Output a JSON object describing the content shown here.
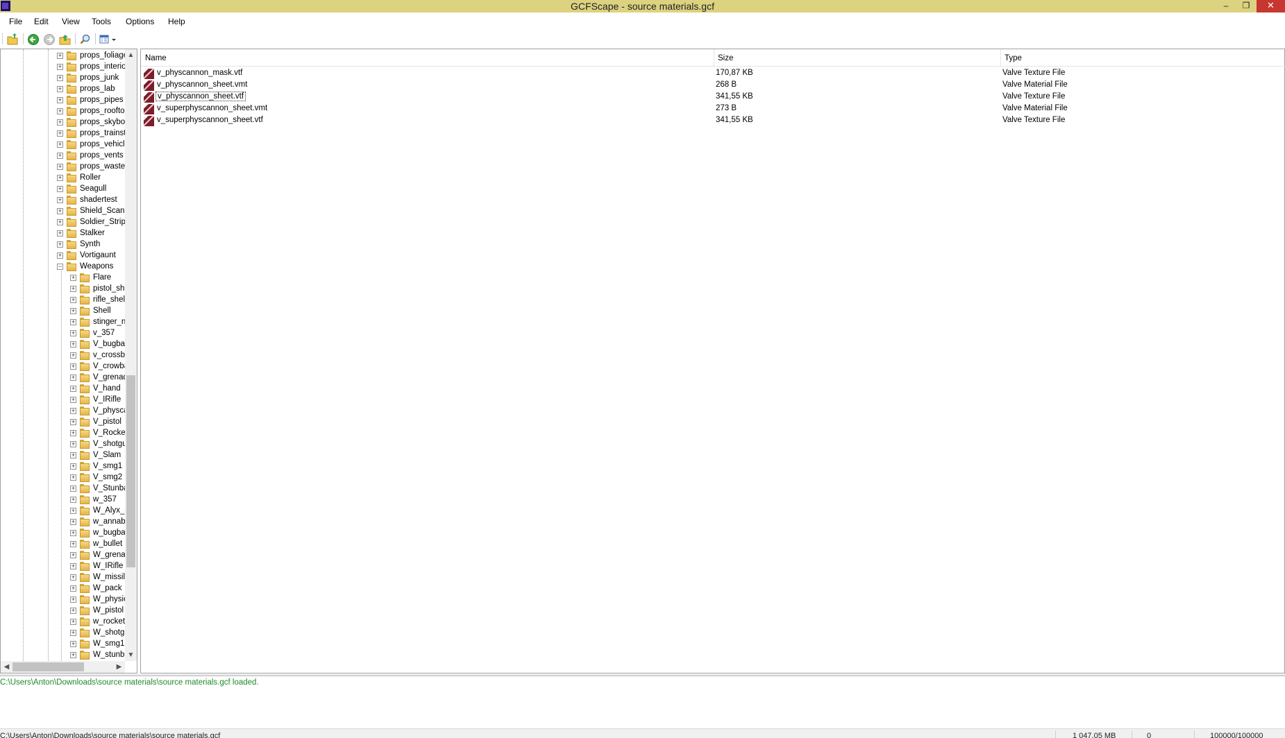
{
  "window": {
    "title": "GCFScape - source materials.gcf",
    "minimize": "–",
    "maximize": "❐",
    "close": "✕"
  },
  "menu": [
    "File",
    "Edit",
    "View",
    "Tools",
    "Options",
    "Help"
  ],
  "toolbar": {
    "icons": [
      "open-icon",
      "back-icon",
      "forward-icon",
      "up-folder-icon",
      "search-icon",
      "view-mode-icon"
    ]
  },
  "tree": {
    "top_level": [
      "props_foliage",
      "props_interiors",
      "props_junk",
      "props_lab",
      "props_pipes",
      "props_rooftop",
      "props_skybox",
      "props_trainstation",
      "props_vehicles",
      "props_vents",
      "props_wasteland",
      "Roller",
      "Seagull",
      "shadertest",
      "Shield_Scanner",
      "Soldier_Stripped",
      "Stalker",
      "Synth",
      "Vortigaunt",
      "Weapons"
    ],
    "expanded": "Weapons",
    "weapons_children": [
      "Flare",
      "pistol_shell",
      "rifle_shell",
      "Shell",
      "stinger_needle",
      "v_357",
      "V_bugbait",
      "v_crossbow",
      "V_crowbar",
      "V_grenade",
      "V_hand",
      "V_IRifle",
      "V_physcannon",
      "V_pistol",
      "V_Rocket",
      "V_shotgun",
      "V_Slam",
      "V_smg1",
      "V_smg2",
      "V_Stunbaton",
      "w_357",
      "W_Alyx_gun",
      "w_annabelle",
      "w_bugbait",
      "w_bullet",
      "W_grenade",
      "W_IRifle",
      "W_missile",
      "W_pack",
      "W_physics",
      "W_pistol",
      "w_rocket",
      "W_shotgun",
      "W_smg1",
      "W_stunbaton"
    ]
  },
  "list": {
    "columns": [
      "Name",
      "Size",
      "Type"
    ],
    "rows": [
      {
        "name": "v_physcannon_mask.vtf",
        "size": "170,87 KB",
        "type": "Valve Texture File"
      },
      {
        "name": "v_physcannon_sheet.vmt",
        "size": "268 B",
        "type": "Valve Material File"
      },
      {
        "name": "v_physcannon_sheet.vtf",
        "size": "341,55 KB",
        "type": "Valve Texture File"
      },
      {
        "name": "v_superphyscannon_sheet.vmt",
        "size": "273 B",
        "type": "Valve Material File"
      },
      {
        "name": "v_superphyscannon_sheet.vtf",
        "size": "341,55 KB",
        "type": "Valve Texture File"
      }
    ],
    "focused_row": 2
  },
  "log": {
    "message": "C:\\Users\\Anton\\Downloads\\source materials\\source materials.gcf loaded."
  },
  "status": {
    "path": "C:\\Users\\Anton\\Downloads\\source materials\\source materials.gcf",
    "size": "1 047,05 MB",
    "count": "0",
    "blocks": "100000/100000"
  },
  "colors": {
    "titlebar": "#dcd27f",
    "close": "#c7372f",
    "log_text": "#20892b"
  }
}
